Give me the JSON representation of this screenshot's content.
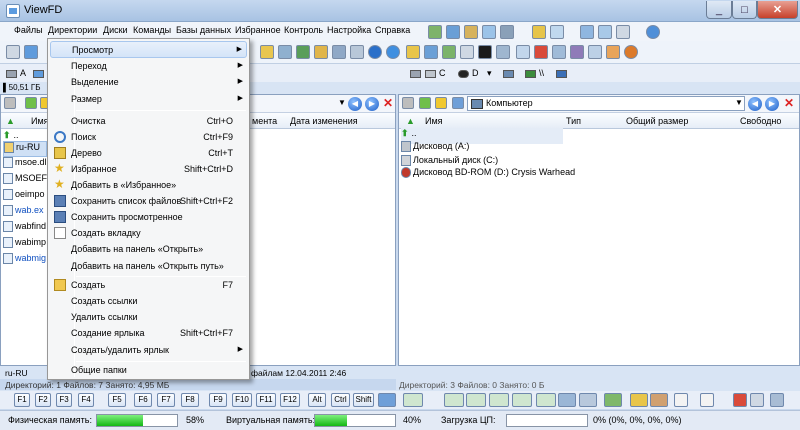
{
  "window": {
    "title": "ViewFD"
  },
  "menubar": [
    "Файлы",
    "Директории",
    "Диски",
    "Команды",
    "Базы данных",
    "Избранное",
    "Контроль",
    "Настройка",
    "Справка"
  ],
  "left_panel": {
    "info": "50,51 ГБ",
    "columns": {
      "name": "Имя",
      "date_partial": "мента",
      "date": "Дата изменения"
    },
    "up": "..",
    "items": [
      "ru-RU",
      "msoe.dl",
      "MSOEF",
      "oeimpo",
      "wab.ex",
      "wabfind",
      "wabimp",
      "wabmig"
    ],
    "status_name": "ru-RU",
    "status_right": "файлам  12.04.2011 2:46",
    "summary": "Директорий: 1  Файлов: 7  Занято: 4,95 МБ"
  },
  "right_panel": {
    "path": "Компьютер",
    "columns": {
      "name": "Имя",
      "type": "Тип",
      "total": "Общий размер",
      "free": "Свободно"
    },
    "up": "..",
    "items": [
      "Дисковод (A:)",
      "Локальный диск (C:)",
      "Дисковод BD-ROM (D:) Crysis Warhead"
    ],
    "summary": "Директорий: 3  Файлов: 0  Занято: 0 Б"
  },
  "drives_left": [
    "A"
  ],
  "drives_right": [
    "C",
    "D",
    "\\\\"
  ],
  "context_menu": {
    "items": [
      {
        "label": "Просмотр",
        "shortcut": "",
        "arrow": "▶"
      },
      {
        "label": "Переход",
        "shortcut": "",
        "arrow": "▶"
      },
      {
        "label": "Выделение",
        "shortcut": "",
        "arrow": "▶"
      },
      {
        "label": "Размер",
        "shortcut": "",
        "arrow": "▶"
      },
      {
        "label": "Очистка",
        "shortcut": "Ctrl+O",
        "arrow": ""
      },
      {
        "label": "Поиск",
        "shortcut": "Ctrl+F9",
        "arrow": ""
      },
      {
        "label": "Дерево",
        "shortcut": "Ctrl+T",
        "arrow": ""
      },
      {
        "label": "Избранное",
        "shortcut": "Shift+Ctrl+D",
        "arrow": ""
      },
      {
        "label": "Добавить в «Избранное»",
        "shortcut": "",
        "arrow": ""
      },
      {
        "label": "Сохранить список файлов",
        "shortcut": "Shift+Ctrl+F2",
        "arrow": ""
      },
      {
        "label": "Сохранить просмотренное",
        "shortcut": "",
        "arrow": ""
      },
      {
        "label": "Создать вкладку",
        "shortcut": "",
        "arrow": ""
      },
      {
        "label": "Добавить на панель «Открыть»",
        "shortcut": "",
        "arrow": ""
      },
      {
        "label": "Добавить на панель «Открыть путь»",
        "shortcut": "",
        "arrow": ""
      },
      {
        "label": "Создать",
        "shortcut": "F7",
        "arrow": ""
      },
      {
        "label": "Создать ссылки",
        "shortcut": "",
        "arrow": ""
      },
      {
        "label": "Удалить ссылки",
        "shortcut": "",
        "arrow": ""
      },
      {
        "label": "Создание ярлыка",
        "shortcut": "Shift+Ctrl+F7",
        "arrow": ""
      },
      {
        "label": "Создать/удалить ярлык",
        "shortcut": "",
        "arrow": "▶"
      },
      {
        "label": "Общие папки",
        "shortcut": "",
        "arrow": ""
      }
    ]
  },
  "fkeys": [
    "F1",
    "F2",
    "F3",
    "F4",
    "F5",
    "F6",
    "F7",
    "F8",
    "F9",
    "F10",
    "F11",
    "F12",
    "Alt",
    "Ctrl",
    "Shift"
  ],
  "memory": {
    "physical_label": "Физическая память:",
    "physical_value": "58%",
    "physical_fraction": 0.58,
    "virtual_label": "Виртуальная память:",
    "virtual_value": "40%",
    "virtual_fraction": 0.4,
    "cpu_label": "Загрузка ЦП:",
    "cpu_value": "0% (0%, 0%, 0%, 0%)"
  }
}
